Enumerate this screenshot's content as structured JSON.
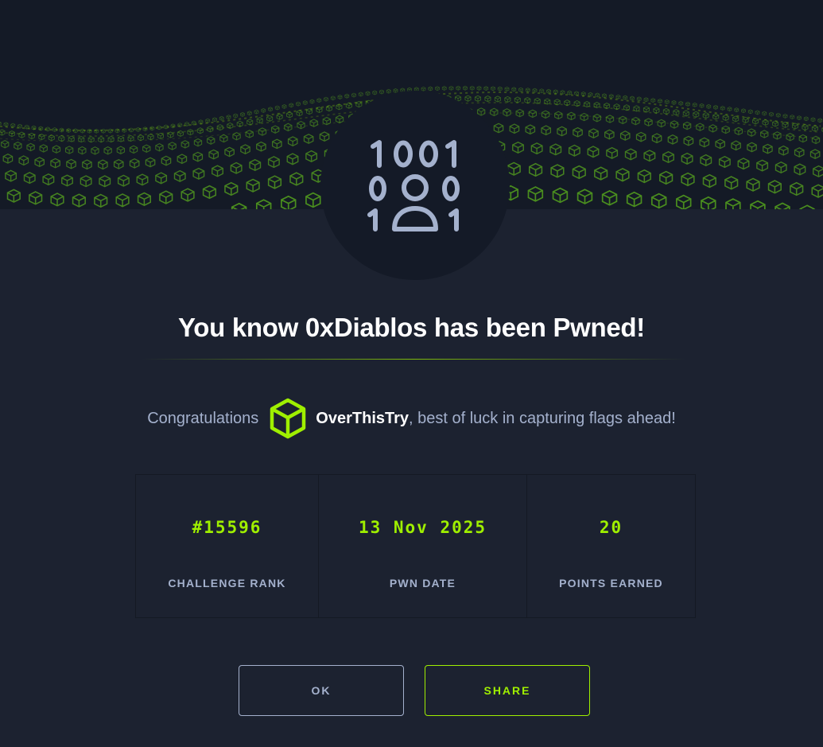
{
  "banner": {
    "icon": "green-cube-wave-pattern"
  },
  "badge": {
    "icon": "binary-user-icon"
  },
  "title": "You know 0xDiablos has been Pwned!",
  "congrats": {
    "prefix": "Congratulations",
    "username": "OverThisTry",
    "suffix": ", best of luck in capturing flags ahead!",
    "icon": "cube-icon",
    "accent": "#9fef00"
  },
  "stats": [
    {
      "value": "#15596",
      "label": "CHALLENGE RANK"
    },
    {
      "value": "13 Nov 2025",
      "label": "PWN DATE"
    },
    {
      "value": "20",
      "label": "POINTS EARNED"
    }
  ],
  "buttons": {
    "ok": "OK",
    "share": "SHARE"
  }
}
